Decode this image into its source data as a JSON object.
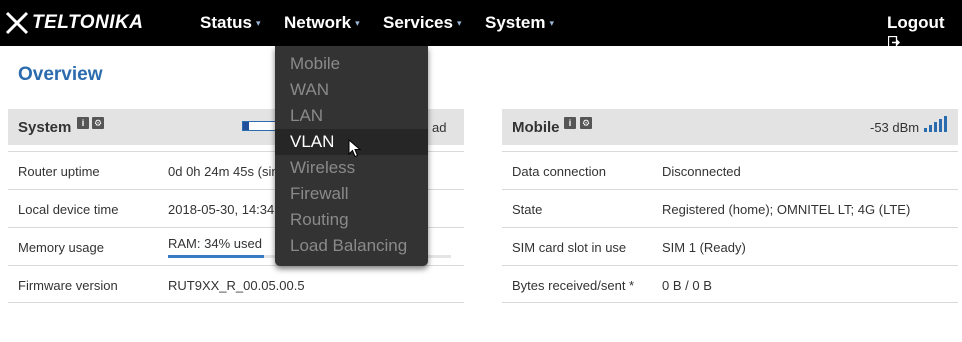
{
  "brand": {
    "logo_text": "TELTONIKA"
  },
  "nav": {
    "items": [
      {
        "label": "Status"
      },
      {
        "label": "Network"
      },
      {
        "label": "Services"
      },
      {
        "label": "System"
      }
    ],
    "caret": "▾",
    "logout_label": "Logout"
  },
  "network_menu": {
    "items": [
      {
        "label": "Mobile"
      },
      {
        "label": "WAN"
      },
      {
        "label": "LAN"
      },
      {
        "label": "VLAN"
      },
      {
        "label": "Wireless"
      },
      {
        "label": "Firewall"
      },
      {
        "label": "Routing"
      },
      {
        "label": "Load Balancing"
      }
    ],
    "highlighted": "VLAN"
  },
  "page": {
    "title": "Overview"
  },
  "system_panel": {
    "title": "System",
    "info_icon_glyph": "i",
    "settings_icon_glyph": "⚙",
    "load_label_fragment": "ad",
    "load_fraction": 0.17,
    "rows": [
      {
        "key": "Router uptime",
        "value": "0d 0h 24m 45s (sin"
      },
      {
        "key": "Local device time",
        "value": "2018-05-30, 14:34"
      },
      {
        "key": "Memory usage",
        "value": "RAM: 34% used",
        "fraction": 0.34
      },
      {
        "key": "Firmware version",
        "value": "RUT9XX_R_00.05.00.5"
      }
    ]
  },
  "mobile_panel": {
    "title": "Mobile",
    "info_icon_glyph": "i",
    "settings_icon_glyph": "⚙",
    "signal": "-53 dBm",
    "signal_bars_active": 5,
    "rows": [
      {
        "key": "Data connection",
        "value": "Disconnected"
      },
      {
        "key": "State",
        "value": "Registered (home); OMNITEL LT; 4G (LTE)"
      },
      {
        "key": "SIM card slot in use",
        "value": "SIM 1 (Ready)"
      },
      {
        "key": "Bytes received/sent *",
        "value": "0 B / 0 B"
      }
    ]
  },
  "colors": {
    "topbar": "#000000",
    "accent_blue": "#2b6cae",
    "dropdown_bg": "#333333",
    "panel_header": "#e3e3e3"
  }
}
